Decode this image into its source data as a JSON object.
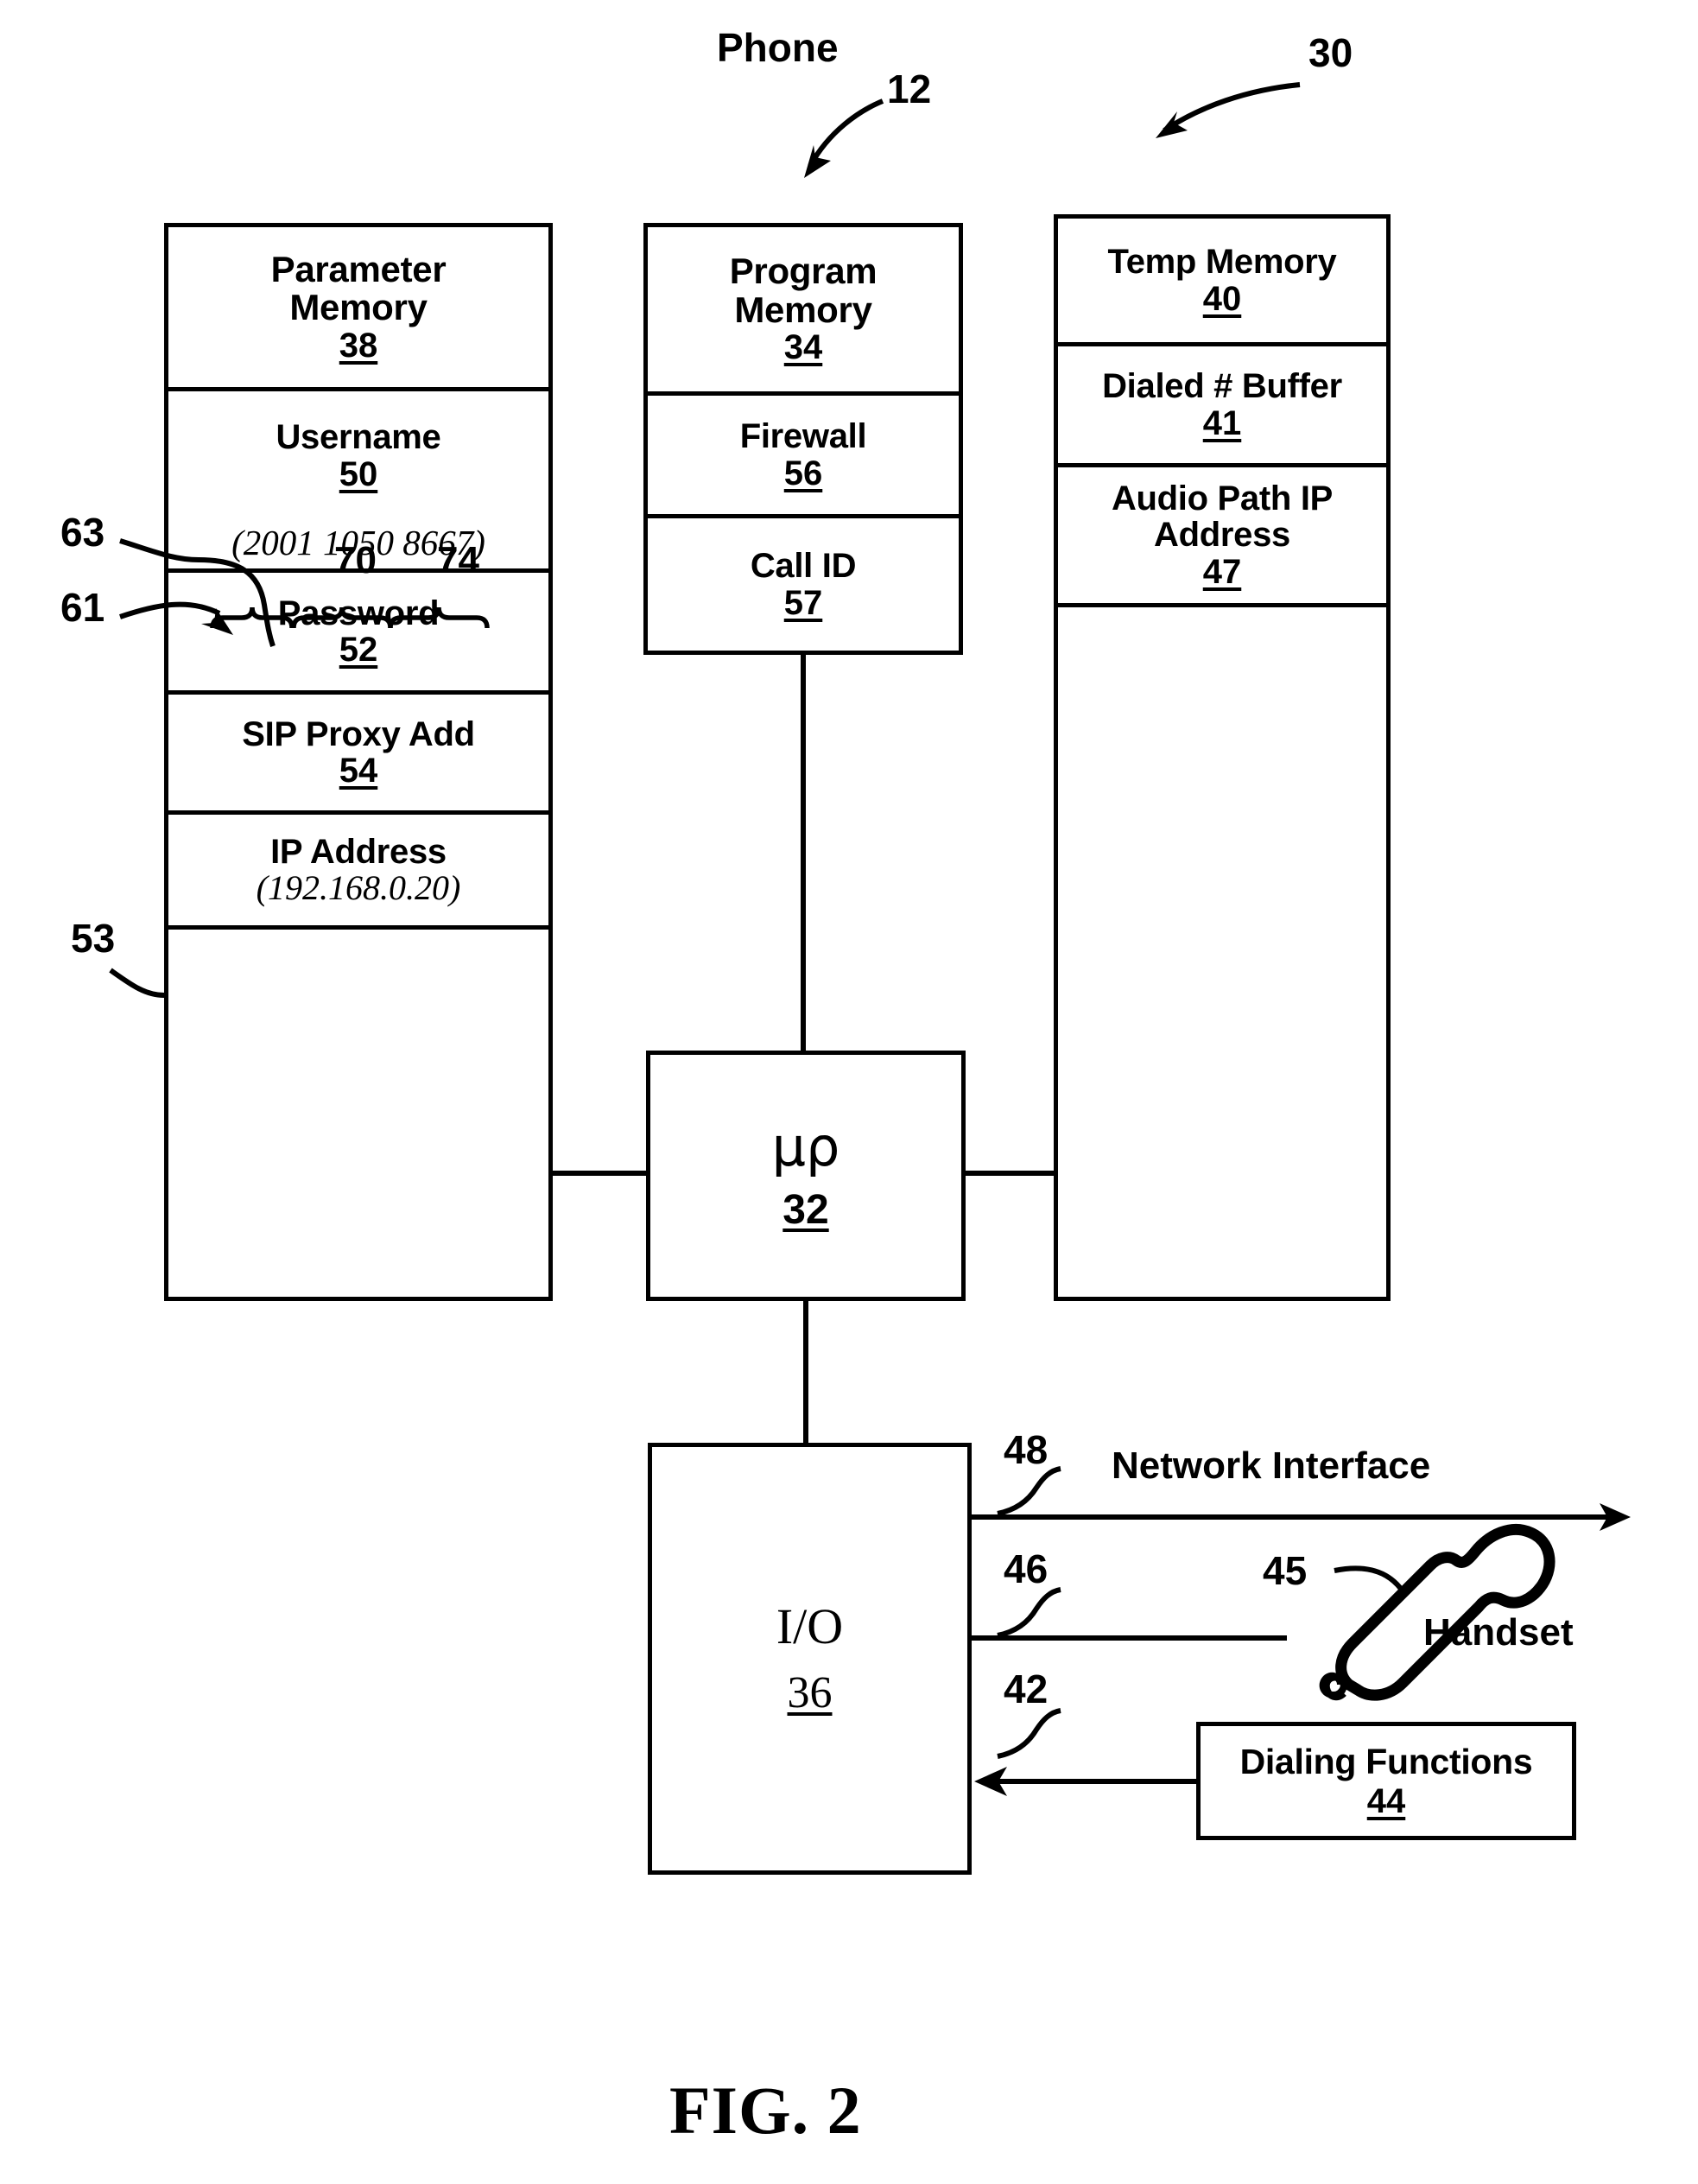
{
  "figure": {
    "caption": "FIG. 2",
    "top_label": "Phone",
    "ref_phone": "12",
    "ref_system": "30"
  },
  "columns": {
    "parameter_memory": {
      "ref_container": "38",
      "cells": [
        {
          "title": "Parameter Memory",
          "num": "38",
          "value": ""
        },
        {
          "title": "Username",
          "num": "50",
          "value": "(2001 1050 8667)"
        },
        {
          "title": "Password",
          "num": "52",
          "value": ""
        },
        {
          "title": "SIP Proxy Add",
          "num": "54",
          "value": ""
        },
        {
          "title": "IP Address",
          "num": "",
          "value": "(192.168.0.20)"
        },
        {
          "title": "",
          "num": "",
          "value": ""
        }
      ]
    },
    "program_memory": {
      "cells": [
        {
          "title": "Program Memory",
          "num": "34"
        },
        {
          "title": "Firewall",
          "num": "56"
        },
        {
          "title": "Call ID",
          "num": "57"
        }
      ]
    },
    "temp_memory": {
      "cells": [
        {
          "title": "Temp Memory",
          "num": "40"
        },
        {
          "title": "Dialed # Buffer",
          "num": "41"
        },
        {
          "title": "Audio Path IP Address",
          "num": "47"
        },
        {
          "title": "",
          "num": ""
        }
      ]
    }
  },
  "blocks": {
    "processor": {
      "symbol": "μρ",
      "num": "32"
    },
    "io": {
      "symbol": "I/O",
      "num": "36"
    },
    "dialing": {
      "title": "Dialing Functions",
      "num": "44"
    }
  },
  "username_fields": {
    "brace_left_num": "70",
    "brace_right_num": "74",
    "ref_arrow_upper": "63",
    "ref_arrow_lower": "61"
  },
  "refs": {
    "ip_address": "53",
    "network_interface": "48",
    "handset_line": "46",
    "dialing_line": "42",
    "handset_icon": "45"
  },
  "io_ports": {
    "network_interface": "Network Interface",
    "handset": "Handset"
  }
}
